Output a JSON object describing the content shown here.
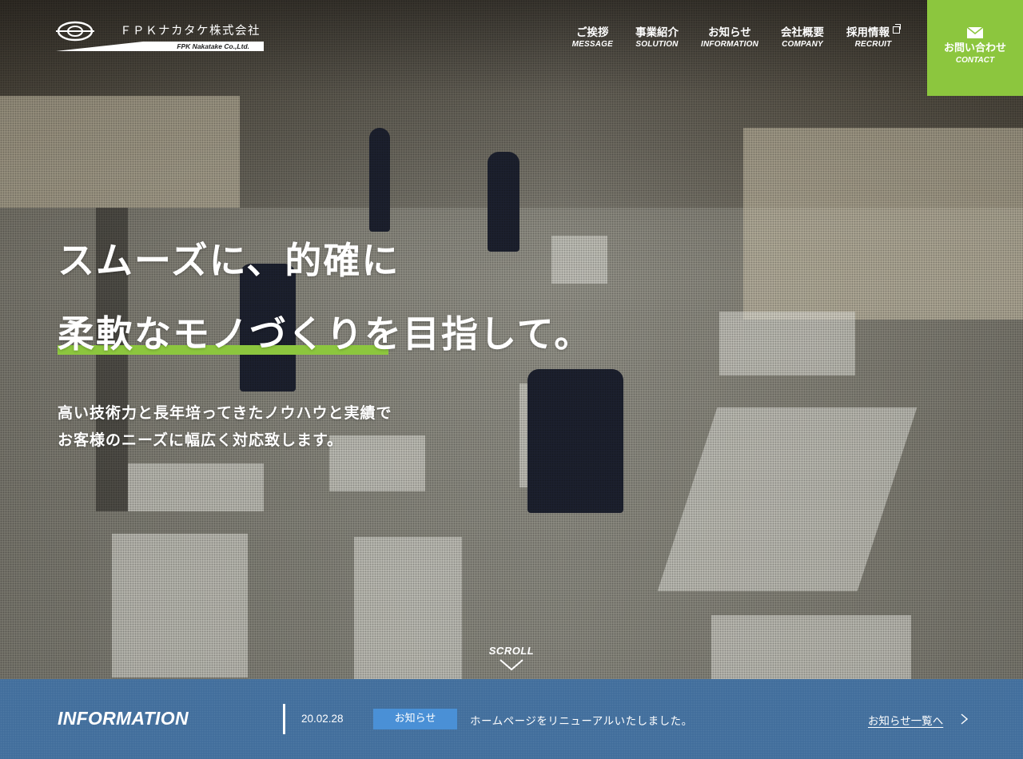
{
  "logo": {
    "name_jp": "ＦＰＫナカタケ株式会社",
    "name_en": "FPK Nakatake Co.,Ltd."
  },
  "nav": {
    "items": [
      {
        "jp": "ご挨拶",
        "en": "MESSAGE"
      },
      {
        "jp": "事業紹介",
        "en": "SOLUTION"
      },
      {
        "jp": "お知らせ",
        "en": "INFORMATION"
      },
      {
        "jp": "会社概要",
        "en": "COMPANY"
      },
      {
        "jp": "採用情報",
        "en": "RECRUIT",
        "external": true
      }
    ],
    "contact": {
      "jp": "お問い合わせ",
      "en": "CONTACT",
      "icon": "mail-icon"
    }
  },
  "hero": {
    "headline_line1": "スムーズに、的確に",
    "headline_line2_highlight": "柔軟なモノづくり",
    "headline_line2_rest": "を目指して。",
    "sub_line1": "高い技術力と長年培ってきたノウハウと実績で",
    "sub_line2": "お客様のニーズに幅広く対応致します。",
    "scroll": "SCROLL",
    "accent_color": "#8cc63e"
  },
  "information": {
    "title": "INFORMATION",
    "date": "20.02.28",
    "category": "お知らせ",
    "text": "ホームページをリニューアルいたしました。",
    "list_link": "お知らせ一覧へ",
    "bar_color": "#3f6c9b",
    "badge_color": "#4a90d6"
  }
}
